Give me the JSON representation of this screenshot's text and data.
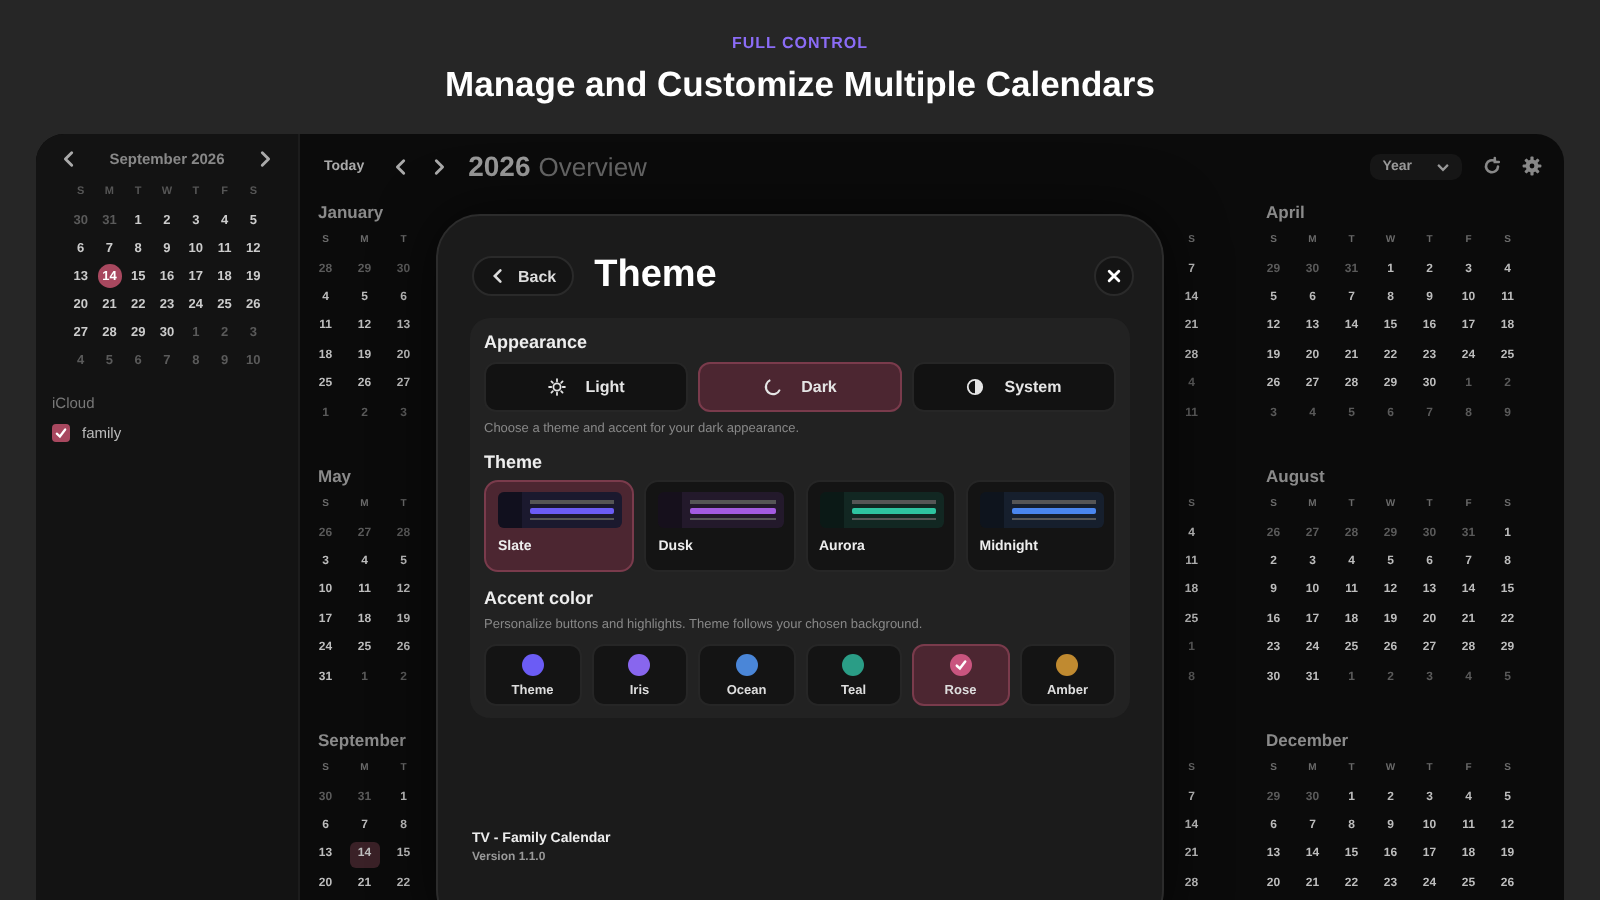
{
  "hero": {
    "eyebrow": "FULL CONTROL",
    "title": "Manage and Customize Multiple Calendars"
  },
  "sidebar": {
    "month_title": "September 2026",
    "weekdays": [
      "S",
      "M",
      "T",
      "W",
      "T",
      "F",
      "S"
    ],
    "weeks": [
      [
        {
          "t": "30",
          "dim": true,
          "today": false
        },
        {
          "t": "31",
          "dim": true,
          "today": false
        },
        {
          "t": "1",
          "dim": false,
          "today": false
        },
        {
          "t": "2",
          "dim": false,
          "today": false
        },
        {
          "t": "3",
          "dim": false,
          "today": false
        },
        {
          "t": "4",
          "dim": false,
          "today": false
        },
        {
          "t": "5",
          "dim": false,
          "today": false
        }
      ],
      [
        {
          "t": "6",
          "dim": false,
          "today": false
        },
        {
          "t": "7",
          "dim": false,
          "today": false
        },
        {
          "t": "8",
          "dim": false,
          "today": false
        },
        {
          "t": "9",
          "dim": false,
          "today": false
        },
        {
          "t": "10",
          "dim": false,
          "today": false
        },
        {
          "t": "11",
          "dim": false,
          "today": false
        },
        {
          "t": "12",
          "dim": false,
          "today": false
        }
      ],
      [
        {
          "t": "13",
          "dim": false,
          "today": false
        },
        {
          "t": "14",
          "dim": false,
          "today": true
        },
        {
          "t": "15",
          "dim": false,
          "today": false
        },
        {
          "t": "16",
          "dim": false,
          "today": false
        },
        {
          "t": "17",
          "dim": false,
          "today": false
        },
        {
          "t": "18",
          "dim": false,
          "today": false
        },
        {
          "t": "19",
          "dim": false,
          "today": false
        }
      ],
      [
        {
          "t": "20",
          "dim": false,
          "today": false
        },
        {
          "t": "21",
          "dim": false,
          "today": false
        },
        {
          "t": "22",
          "dim": false,
          "today": false
        },
        {
          "t": "23",
          "dim": false,
          "today": false
        },
        {
          "t": "24",
          "dim": false,
          "today": false
        },
        {
          "t": "25",
          "dim": false,
          "today": false
        },
        {
          "t": "26",
          "dim": false,
          "today": false
        }
      ],
      [
        {
          "t": "27",
          "dim": false,
          "today": false
        },
        {
          "t": "28",
          "dim": false,
          "today": false
        },
        {
          "t": "29",
          "dim": false,
          "today": false
        },
        {
          "t": "30",
          "dim": false,
          "today": false
        },
        {
          "t": "1",
          "dim": true,
          "today": false
        },
        {
          "t": "2",
          "dim": true,
          "today": false
        },
        {
          "t": "3",
          "dim": true,
          "today": false
        }
      ],
      [
        {
          "t": "4",
          "dim": true,
          "today": false
        },
        {
          "t": "5",
          "dim": true,
          "today": false
        },
        {
          "t": "6",
          "dim": true,
          "today": false
        },
        {
          "t": "7",
          "dim": true,
          "today": false
        },
        {
          "t": "8",
          "dim": true,
          "today": false
        },
        {
          "t": "9",
          "dim": true,
          "today": false
        },
        {
          "t": "10",
          "dim": true,
          "today": false
        }
      ]
    ],
    "account": "iCloud",
    "calendars": [
      {
        "name": "family",
        "checked": true,
        "color": "#a8485f"
      }
    ]
  },
  "toolbar": {
    "today": "Today",
    "year": "2026",
    "subtitle": "Overview",
    "view": "Year"
  },
  "year_grid": [
    [
      {
        "kind": "left_part",
        "name": "January",
        "weekdays": [
          "S",
          "M",
          "T"
        ],
        "weeks": [
          [
            {
              "t": "28",
              "dim": true,
              "today": false
            },
            {
              "t": "29",
              "dim": true,
              "today": false
            },
            {
              "t": "30",
              "dim": true,
              "today": false
            }
          ],
          [
            {
              "t": "4",
              "dim": false,
              "today": false
            },
            {
              "t": "5",
              "dim": false,
              "today": false
            },
            {
              "t": "6",
              "dim": false,
              "today": false
            }
          ],
          [
            {
              "t": "11",
              "dim": false,
              "today": false
            },
            {
              "t": "12",
              "dim": false,
              "today": false
            },
            {
              "t": "13",
              "dim": false,
              "today": false
            }
          ],
          [
            {
              "t": "18",
              "dim": false,
              "today": false
            },
            {
              "t": "19",
              "dim": false,
              "today": false
            },
            {
              "t": "20",
              "dim": false,
              "today": false
            }
          ],
          [
            {
              "t": "25",
              "dim": false,
              "today": false
            },
            {
              "t": "26",
              "dim": false,
              "today": false
            },
            {
              "t": "27",
              "dim": false,
              "today": false
            }
          ],
          [
            {
              "t": "1",
              "dim": true,
              "today": false
            },
            {
              "t": "2",
              "dim": true,
              "today": false
            },
            {
              "t": "3",
              "dim": true,
              "today": false
            }
          ]
        ]
      },
      {
        "kind": "right_part",
        "weekdays": [
          "S"
        ],
        "weeks": [
          [
            {
              "t": "7",
              "dim": false,
              "today": false
            }
          ],
          [
            {
              "t": "14",
              "dim": false,
              "today": false
            }
          ],
          [
            {
              "t": "21",
              "dim": false,
              "today": false
            }
          ],
          [
            {
              "t": "28",
              "dim": false,
              "today": false
            }
          ],
          [
            {
              "t": "4",
              "dim": true,
              "today": false
            }
          ],
          [
            {
              "t": "11",
              "dim": true,
              "today": false
            }
          ]
        ]
      },
      {
        "kind": "full",
        "name": "April",
        "weekdays": [
          "S",
          "M",
          "T",
          "W",
          "T",
          "F",
          "S"
        ],
        "weeks": [
          [
            {
              "t": "29",
              "dim": true,
              "today": false
            },
            {
              "t": "30",
              "dim": true,
              "today": false
            },
            {
              "t": "31",
              "dim": true,
              "today": false
            },
            {
              "t": "1",
              "dim": false,
              "today": false
            },
            {
              "t": "2",
              "dim": false,
              "today": false
            },
            {
              "t": "3",
              "dim": false,
              "today": false
            },
            {
              "t": "4",
              "dim": false,
              "today": false
            }
          ],
          [
            {
              "t": "5",
              "dim": false,
              "today": false
            },
            {
              "t": "6",
              "dim": false,
              "today": false
            },
            {
              "t": "7",
              "dim": false,
              "today": false
            },
            {
              "t": "8",
              "dim": false,
              "today": false
            },
            {
              "t": "9",
              "dim": false,
              "today": false
            },
            {
              "t": "10",
              "dim": false,
              "today": false
            },
            {
              "t": "11",
              "dim": false,
              "today": false
            }
          ],
          [
            {
              "t": "12",
              "dim": false,
              "today": false
            },
            {
              "t": "13",
              "dim": false,
              "today": false
            },
            {
              "t": "14",
              "dim": false,
              "today": false
            },
            {
              "t": "15",
              "dim": false,
              "today": false
            },
            {
              "t": "16",
              "dim": false,
              "today": false
            },
            {
              "t": "17",
              "dim": false,
              "today": false
            },
            {
              "t": "18",
              "dim": false,
              "today": false
            }
          ],
          [
            {
              "t": "19",
              "dim": false,
              "today": false
            },
            {
              "t": "20",
              "dim": false,
              "today": false
            },
            {
              "t": "21",
              "dim": false,
              "today": false
            },
            {
              "t": "22",
              "dim": false,
              "today": false
            },
            {
              "t": "23",
              "dim": false,
              "today": false
            },
            {
              "t": "24",
              "dim": false,
              "today": false
            },
            {
              "t": "25",
              "dim": false,
              "today": false
            }
          ],
          [
            {
              "t": "26",
              "dim": false,
              "today": false
            },
            {
              "t": "27",
              "dim": false,
              "today": false
            },
            {
              "t": "28",
              "dim": false,
              "today": false
            },
            {
              "t": "29",
              "dim": false,
              "today": false
            },
            {
              "t": "30",
              "dim": false,
              "today": false
            },
            {
              "t": "1",
              "dim": true,
              "today": false
            },
            {
              "t": "2",
              "dim": true,
              "today": false
            }
          ],
          [
            {
              "t": "3",
              "dim": true,
              "today": false
            },
            {
              "t": "4",
              "dim": true,
              "today": false
            },
            {
              "t": "5",
              "dim": true,
              "today": false
            },
            {
              "t": "6",
              "dim": true,
              "today": false
            },
            {
              "t": "7",
              "dim": true,
              "today": false
            },
            {
              "t": "8",
              "dim": true,
              "today": false
            },
            {
              "t": "9",
              "dim": true,
              "today": false
            }
          ]
        ]
      }
    ],
    [
      {
        "kind": "left_part",
        "name": "May",
        "weekdays": [
          "S",
          "M",
          "T"
        ],
        "weeks": [
          [
            {
              "t": "26",
              "dim": true,
              "today": false
            },
            {
              "t": "27",
              "dim": true,
              "today": false
            },
            {
              "t": "28",
              "dim": true,
              "today": false
            }
          ],
          [
            {
              "t": "3",
              "dim": false,
              "today": false
            },
            {
              "t": "4",
              "dim": false,
              "today": false
            },
            {
              "t": "5",
              "dim": false,
              "today": false
            }
          ],
          [
            {
              "t": "10",
              "dim": false,
              "today": false
            },
            {
              "t": "11",
              "dim": false,
              "today": false
            },
            {
              "t": "12",
              "dim": false,
              "today": false
            }
          ],
          [
            {
              "t": "17",
              "dim": false,
              "today": false
            },
            {
              "t": "18",
              "dim": false,
              "today": false
            },
            {
              "t": "19",
              "dim": false,
              "today": false
            }
          ],
          [
            {
              "t": "24",
              "dim": false,
              "today": false
            },
            {
              "t": "25",
              "dim": false,
              "today": false
            },
            {
              "t": "26",
              "dim": false,
              "today": false
            }
          ],
          [
            {
              "t": "31",
              "dim": false,
              "today": false
            },
            {
              "t": "1",
              "dim": true,
              "today": false
            },
            {
              "t": "2",
              "dim": true,
              "today": false
            }
          ]
        ]
      },
      {
        "kind": "right_part",
        "weekdays": [
          "S"
        ],
        "weeks": [
          [
            {
              "t": "4",
              "dim": false,
              "today": false
            }
          ],
          [
            {
              "t": "11",
              "dim": false,
              "today": false
            }
          ],
          [
            {
              "t": "18",
              "dim": false,
              "today": false
            }
          ],
          [
            {
              "t": "25",
              "dim": false,
              "today": false
            }
          ],
          [
            {
              "t": "1",
              "dim": true,
              "today": false
            }
          ],
          [
            {
              "t": "8",
              "dim": true,
              "today": false
            }
          ]
        ]
      },
      {
        "kind": "full",
        "name": "August",
        "weekdays": [
          "S",
          "M",
          "T",
          "W",
          "T",
          "F",
          "S"
        ],
        "weeks": [
          [
            {
              "t": "26",
              "dim": true,
              "today": false
            },
            {
              "t": "27",
              "dim": true,
              "today": false
            },
            {
              "t": "28",
              "dim": true,
              "today": false
            },
            {
              "t": "29",
              "dim": true,
              "today": false
            },
            {
              "t": "30",
              "dim": true,
              "today": false
            },
            {
              "t": "31",
              "dim": true,
              "today": false
            },
            {
              "t": "1",
              "dim": false,
              "today": false
            }
          ],
          [
            {
              "t": "2",
              "dim": false,
              "today": false
            },
            {
              "t": "3",
              "dim": false,
              "today": false
            },
            {
              "t": "4",
              "dim": false,
              "today": false
            },
            {
              "t": "5",
              "dim": false,
              "today": false
            },
            {
              "t": "6",
              "dim": false,
              "today": false
            },
            {
              "t": "7",
              "dim": false,
              "today": false
            },
            {
              "t": "8",
              "dim": false,
              "today": false
            }
          ],
          [
            {
              "t": "9",
              "dim": false,
              "today": false
            },
            {
              "t": "10",
              "dim": false,
              "today": false
            },
            {
              "t": "11",
              "dim": false,
              "today": false
            },
            {
              "t": "12",
              "dim": false,
              "today": false
            },
            {
              "t": "13",
              "dim": false,
              "today": false
            },
            {
              "t": "14",
              "dim": false,
              "today": false
            },
            {
              "t": "15",
              "dim": false,
              "today": false
            }
          ],
          [
            {
              "t": "16",
              "dim": false,
              "today": false
            },
            {
              "t": "17",
              "dim": false,
              "today": false
            },
            {
              "t": "18",
              "dim": false,
              "today": false
            },
            {
              "t": "19",
              "dim": false,
              "today": false
            },
            {
              "t": "20",
              "dim": false,
              "today": false
            },
            {
              "t": "21",
              "dim": false,
              "today": false
            },
            {
              "t": "22",
              "dim": false,
              "today": false
            }
          ],
          [
            {
              "t": "23",
              "dim": false,
              "today": false
            },
            {
              "t": "24",
              "dim": false,
              "today": false
            },
            {
              "t": "25",
              "dim": false,
              "today": false
            },
            {
              "t": "26",
              "dim": false,
              "today": false
            },
            {
              "t": "27",
              "dim": false,
              "today": false
            },
            {
              "t": "28",
              "dim": false,
              "today": false
            },
            {
              "t": "29",
              "dim": false,
              "today": false
            }
          ],
          [
            {
              "t": "30",
              "dim": false,
              "today": false
            },
            {
              "t": "31",
              "dim": false,
              "today": false
            },
            {
              "t": "1",
              "dim": true,
              "today": false
            },
            {
              "t": "2",
              "dim": true,
              "today": false
            },
            {
              "t": "3",
              "dim": true,
              "today": false
            },
            {
              "t": "4",
              "dim": true,
              "today": false
            },
            {
              "t": "5",
              "dim": true,
              "today": false
            }
          ]
        ]
      }
    ],
    [
      {
        "kind": "left_part",
        "name": "September",
        "weekdays": [
          "S",
          "M",
          "T"
        ],
        "weeks": [
          [
            {
              "t": "30",
              "dim": true,
              "today": false
            },
            {
              "t": "31",
              "dim": true,
              "today": false
            },
            {
              "t": "1",
              "dim": false,
              "today": false
            }
          ],
          [
            {
              "t": "6",
              "dim": false,
              "today": false
            },
            {
              "t": "7",
              "dim": false,
              "today": false
            },
            {
              "t": "8",
              "dim": false,
              "today": false
            }
          ],
          [
            {
              "t": "13",
              "dim": false,
              "today": false
            },
            {
              "t": "14",
              "dim": false,
              "today": true
            },
            {
              "t": "15",
              "dim": false,
              "today": false
            }
          ],
          [
            {
              "t": "20",
              "dim": false,
              "today": false
            },
            {
              "t": "21",
              "dim": false,
              "today": false
            },
            {
              "t": "22",
              "dim": false,
              "today": false
            }
          ]
        ]
      },
      {
        "kind": "right_part",
        "weekdays": [
          "S"
        ],
        "weeks": [
          [
            {
              "t": "7",
              "dim": false,
              "today": false
            }
          ],
          [
            {
              "t": "14",
              "dim": false,
              "today": false
            }
          ],
          [
            {
              "t": "21",
              "dim": false,
              "today": false
            }
          ],
          [
            {
              "t": "28",
              "dim": false,
              "today": false
            }
          ]
        ]
      },
      {
        "kind": "full",
        "name": "December",
        "weekdays": [
          "S",
          "M",
          "T",
          "W",
          "T",
          "F",
          "S"
        ],
        "weeks": [
          [
            {
              "t": "29",
              "dim": true,
              "today": false
            },
            {
              "t": "30",
              "dim": true,
              "today": false
            },
            {
              "t": "1",
              "dim": false,
              "today": false
            },
            {
              "t": "2",
              "dim": false,
              "today": false
            },
            {
              "t": "3",
              "dim": false,
              "today": false
            },
            {
              "t": "4",
              "dim": false,
              "today": false
            },
            {
              "t": "5",
              "dim": false,
              "today": false
            }
          ],
          [
            {
              "t": "6",
              "dim": false,
              "today": false
            },
            {
              "t": "7",
              "dim": false,
              "today": false
            },
            {
              "t": "8",
              "dim": false,
              "today": false
            },
            {
              "t": "9",
              "dim": false,
              "today": false
            },
            {
              "t": "10",
              "dim": false,
              "today": false
            },
            {
              "t": "11",
              "dim": false,
              "today": false
            },
            {
              "t": "12",
              "dim": false,
              "today": false
            }
          ],
          [
            {
              "t": "13",
              "dim": false,
              "today": false
            },
            {
              "t": "14",
              "dim": false,
              "today": false
            },
            {
              "t": "15",
              "dim": false,
              "today": false
            },
            {
              "t": "16",
              "dim": false,
              "today": false
            },
            {
              "t": "17",
              "dim": false,
              "today": false
            },
            {
              "t": "18",
              "dim": false,
              "today": false
            },
            {
              "t": "19",
              "dim": false,
              "today": false
            }
          ],
          [
            {
              "t": "20",
              "dim": false,
              "today": false
            },
            {
              "t": "21",
              "dim": false,
              "today": false
            },
            {
              "t": "22",
              "dim": false,
              "today": false
            },
            {
              "t": "23",
              "dim": false,
              "today": false
            },
            {
              "t": "24",
              "dim": false,
              "today": false
            },
            {
              "t": "25",
              "dim": false,
              "today": false
            },
            {
              "t": "26",
              "dim": false,
              "today": false
            }
          ]
        ]
      }
    ]
  ],
  "dialog": {
    "back": "Back",
    "title": "Theme",
    "appearance": {
      "label": "Appearance",
      "options": [
        {
          "kind": "light",
          "label": "Light",
          "selected": false
        },
        {
          "kind": "dark",
          "label": "Dark",
          "selected": true
        },
        {
          "kind": "system",
          "label": "System",
          "selected": false
        }
      ],
      "hint": "Choose a theme and accent for your dark appearance."
    },
    "theme": {
      "label": "Theme",
      "options": [
        {
          "name": "Slate",
          "color": "#6b5cf5",
          "selected": true
        },
        {
          "name": "Dusk",
          "color": "#a35be0",
          "selected": false
        },
        {
          "name": "Aurora",
          "color": "#2ec4a0",
          "selected": false
        },
        {
          "name": "Midnight",
          "color": "#4a86ee",
          "selected": false
        }
      ]
    },
    "accent": {
      "label": "Accent color",
      "hint": "Personalize buttons and highlights. Theme follows your chosen background.",
      "options": [
        {
          "name": "Theme",
          "color": "#6b5cf5",
          "selected": false
        },
        {
          "name": "Iris",
          "color": "#8866ee",
          "selected": false
        },
        {
          "name": "Ocean",
          "color": "#4a86d8",
          "selected": false
        },
        {
          "name": "Teal",
          "color": "#2a9d86",
          "selected": false
        },
        {
          "name": "Rose",
          "color": "#c9557f",
          "selected": true
        },
        {
          "name": "Amber",
          "color": "#c08a30",
          "selected": false
        }
      ]
    },
    "footer": {
      "app": "TV - Family Calendar",
      "version": "Version 1.1.0"
    }
  }
}
